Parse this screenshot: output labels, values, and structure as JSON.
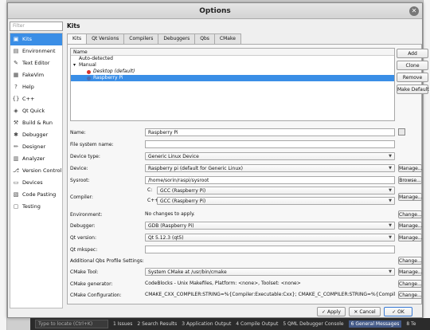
{
  "window": {
    "title": "Options",
    "close_glyph": "✕"
  },
  "filter": {
    "placeholder": "Filter"
  },
  "sidebar": {
    "items": [
      {
        "label": "Kits",
        "icon": "kits-icon",
        "glyph": "▣"
      },
      {
        "label": "Environment",
        "icon": "environment-icon",
        "glyph": "▤"
      },
      {
        "label": "Text Editor",
        "icon": "text-editor-icon",
        "glyph": "✎"
      },
      {
        "label": "FakeVim",
        "icon": "fakevim-icon",
        "glyph": "▦"
      },
      {
        "label": "Help",
        "icon": "help-icon",
        "glyph": "?"
      },
      {
        "label": "C++",
        "icon": "cpp-icon",
        "glyph": "{}"
      },
      {
        "label": "Qt Quick",
        "icon": "qt-quick-icon",
        "glyph": "◈"
      },
      {
        "label": "Build & Run",
        "icon": "build-run-icon",
        "glyph": "⚒"
      },
      {
        "label": "Debugger",
        "icon": "debugger-icon",
        "glyph": "✱"
      },
      {
        "label": "Designer",
        "icon": "designer-icon",
        "glyph": "✏"
      },
      {
        "label": "Analyzer",
        "icon": "analyzer-icon",
        "glyph": "▥"
      },
      {
        "label": "Version Control",
        "icon": "version-control-icon",
        "glyph": "⎇"
      },
      {
        "label": "Devices",
        "icon": "devices-icon",
        "glyph": "▭"
      },
      {
        "label": "Code Pasting",
        "icon": "code-pasting-icon",
        "glyph": "▧"
      },
      {
        "label": "Testing",
        "icon": "testing-icon",
        "glyph": "▢"
      }
    ]
  },
  "page": {
    "title": "Kits"
  },
  "tabs": [
    "Kits",
    "Qt Versions",
    "Compilers",
    "Debuggers",
    "Qbs",
    "CMake"
  ],
  "tree": {
    "header": "Name",
    "auto_detected": "Auto-detected",
    "manual": "Manual",
    "expand_glyph": "▾",
    "desktop": "Desktop (default)",
    "raspberry": "Raspberry Pi",
    "error_color": "#d9342b",
    "kit_color": "#4a6fb5"
  },
  "kit_buttons": {
    "add": "Add",
    "clone": "Clone",
    "remove": "Remove",
    "make_default": "Make Default"
  },
  "form": {
    "name_label": "Name:",
    "name_value": "Raspberry Pi",
    "fs_label": "File system name:",
    "fs_value": "",
    "device_type_label": "Device type:",
    "device_type_value": "Generic Linux Device",
    "device_label": "Device:",
    "device_value": "Raspberry pi (default for Generic Linux)",
    "sysroot_label": "Sysroot:",
    "sysroot_value": "/home/sorin/raspi/sysroot",
    "compiler_label": "Compiler:",
    "c_label": "C:",
    "c_value": "GCC (Raspberry Pi)",
    "cpp_label": "C++:",
    "cpp_value": "GCC (Raspberry Pi)",
    "environment_label": "Environment:",
    "environment_value": "No changes to apply.",
    "debugger_label": "Debugger:",
    "debugger_value": "GDB (Raspberry Pi)",
    "qt_version_label": "Qt version:",
    "qt_version_value": "Qt 5.12.3 (qt5)",
    "qt_mkspec_label": "Qt mkspec:",
    "qt_mkspec_value": "",
    "qbs_label": "Additional Qbs Profile Settings:",
    "cmake_tool_label": "CMake Tool:",
    "cmake_tool_value": "System CMake at /usr/bin/cmake",
    "cmake_gen_label": "CMake generator:",
    "cmake_gen_value": "CodeBlocks - Unix Makefiles, Platform: <none>, Toolset: <none>",
    "cmake_conf_label": "CMake Configuration:",
    "cmake_conf_value": "CMAKE_CXX_COMPILER:STRING=%{Compiler:Executable:Cxx}; CMAKE_C_COMPILER:STRING=%{Compiler:Executable:C..."
  },
  "row_buttons": {
    "manage": "Manage...",
    "browse": "Browse...",
    "change": "Change..."
  },
  "footer": {
    "apply": "Apply",
    "cancel": "Cancel",
    "ok": "OK",
    "apply_glyph": "✓",
    "cancel_glyph": "✕",
    "ok_glyph": "✓"
  },
  "taskbar": {
    "search_placeholder": "Type to locate (Ctrl+K)",
    "items": [
      "1 Issues",
      "2 Search Results",
      "3 Application Output",
      "4 Compile Output",
      "5 QML Debugger Console",
      "6 General Messages",
      "8 Te"
    ]
  }
}
